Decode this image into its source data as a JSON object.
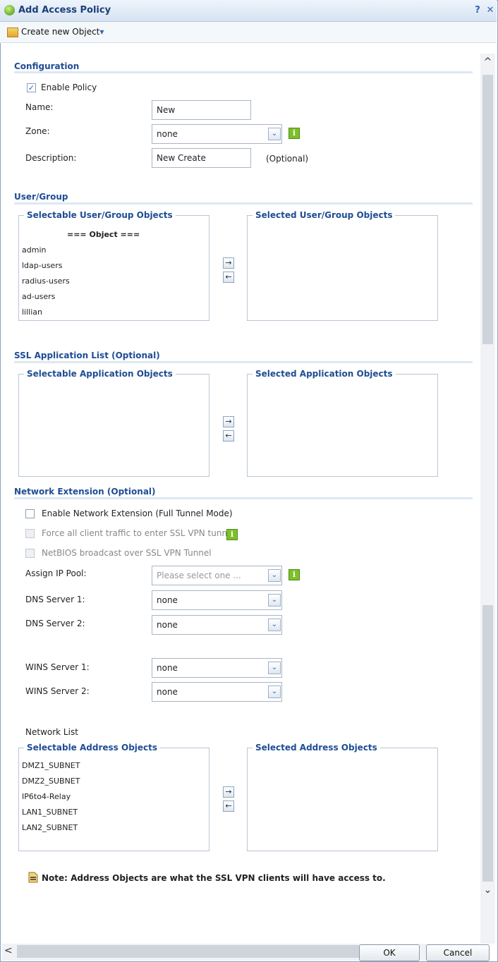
{
  "window": {
    "title": "Add Access Policy",
    "help_label": "?",
    "close_label": "✕"
  },
  "toolbar": {
    "create_label": "Create new Object",
    "caret": "▾"
  },
  "configuration": {
    "title": "Configuration",
    "enable_policy_label": "Enable Policy",
    "enable_policy_checked": true,
    "name_label": "Name:",
    "name_value": "New",
    "zone_label": "Zone:",
    "zone_value": "none",
    "description_label": "Description:",
    "description_value": "New Create",
    "optional_label": "(Optional)"
  },
  "user_group": {
    "title": "User/Group",
    "selectable_legend": "Selectable User/Group Objects",
    "selected_legend": "Selected User/Group Objects",
    "object_header": "=== Object ===",
    "items": [
      "admin",
      "ldap-users",
      "radius-users",
      "ad-users",
      "lillian"
    ]
  },
  "ssl_app": {
    "title": "SSL Application List (Optional)",
    "selectable_legend": "Selectable Application Objects",
    "selected_legend": "Selected Application Objects"
  },
  "network_ext": {
    "title": "Network Extension (Optional)",
    "enable_label": "Enable Network Extension (Full Tunnel Mode)",
    "force_label": "Force all client traffic to enter SSL VPN tunnel",
    "netbios_label": "NetBIOS broadcast over SSL VPN Tunnel",
    "assign_ip_label": "Assign IP Pool:",
    "assign_ip_placeholder": "Please select one ...",
    "dns1_label": "DNS Server 1:",
    "dns1_value": "none",
    "dns2_label": "DNS Server 2:",
    "dns2_value": "none",
    "wins1_label": "WINS Server 1:",
    "wins1_value": "none",
    "wins2_label": "WINS Server 2:",
    "wins2_value": "none",
    "network_list_label": "Network List",
    "selectable_legend": "Selectable Address Objects",
    "selected_legend": "Selected Address Objects",
    "address_items": [
      "DMZ1_SUBNET",
      "DMZ2_SUBNET",
      "IP6to4-Relay",
      "LAN1_SUBNET",
      "LAN2_SUBNET"
    ]
  },
  "note": "Note: Address Objects are what the SSL VPN clients will have access to.",
  "footer": {
    "ok_label": "OK",
    "cancel_label": "Cancel"
  },
  "icons": {
    "add_arrow": "→",
    "remove_arrow": "←",
    "dropdown": "⌄",
    "info": "i",
    "scroll_up": "^",
    "scroll_down": "⌄",
    "scroll_left": "<",
    "scroll_right": ">"
  }
}
